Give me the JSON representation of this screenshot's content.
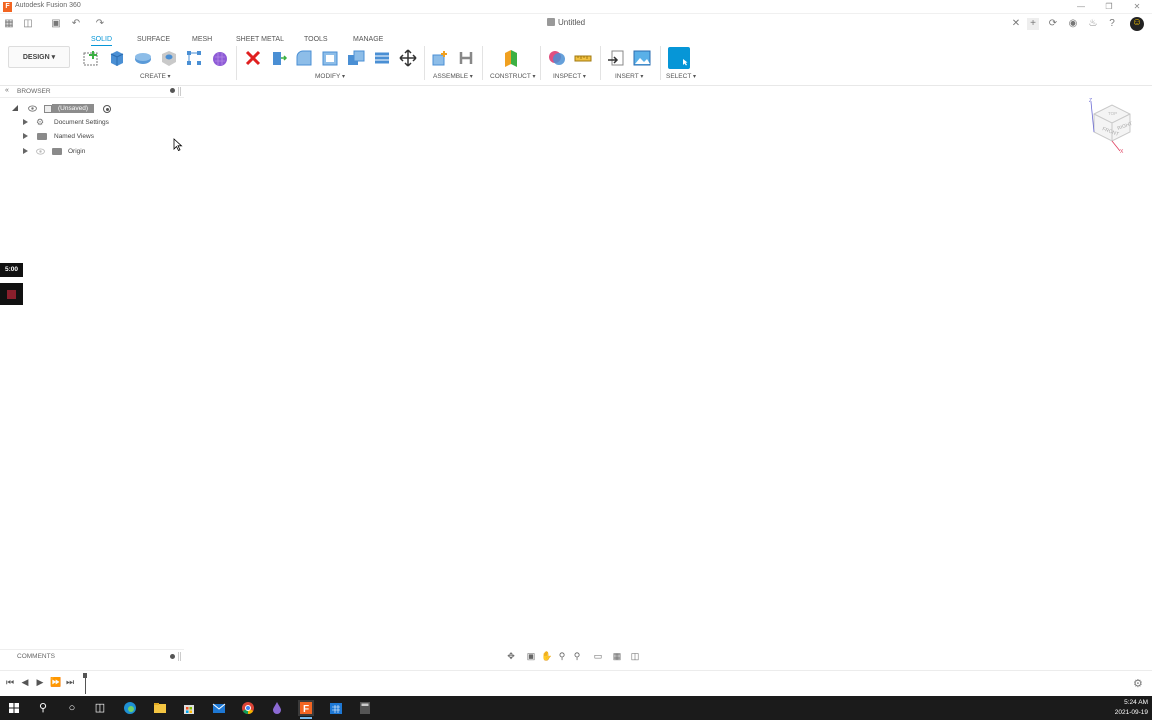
{
  "window": {
    "app_title": "Autodesk Fusion 360",
    "logo_letter": "F",
    "doc_title": "Untitled"
  },
  "ribbon": {
    "workspace": "DESIGN",
    "tabs": [
      {
        "label": "SOLID",
        "active": true
      },
      {
        "label": "SURFACE",
        "active": false
      },
      {
        "label": "MESH",
        "active": false
      },
      {
        "label": "SHEET METAL",
        "active": false
      },
      {
        "label": "TOOLS",
        "active": false
      },
      {
        "label": "MANAGE",
        "active": false
      }
    ],
    "groups": {
      "create": "CREATE",
      "modify": "MODIFY",
      "assemble": "ASSEMBLE",
      "construct": "CONSTRUCT",
      "inspect": "INSPECT",
      "insert": "INSERT",
      "select": "SELECT"
    }
  },
  "browser": {
    "title": "BROWSER",
    "root": "(Unsaved)",
    "items": [
      {
        "label": "Document Settings",
        "icon": "gear-icon"
      },
      {
        "label": "Named Views",
        "icon": "folder-icon"
      },
      {
        "label": "Origin",
        "icon": "folder-icon"
      }
    ]
  },
  "recorder": {
    "time": "5:00"
  },
  "comments": {
    "title": "COMMENTS"
  },
  "taskbar": {
    "time": "5:24 AM",
    "date": "2021-09-19"
  },
  "colors": {
    "accent": "#0696d7",
    "taskbar": "#1b1b1b",
    "fusion_orange": "#f26522",
    "delete_red": "#e02020"
  }
}
